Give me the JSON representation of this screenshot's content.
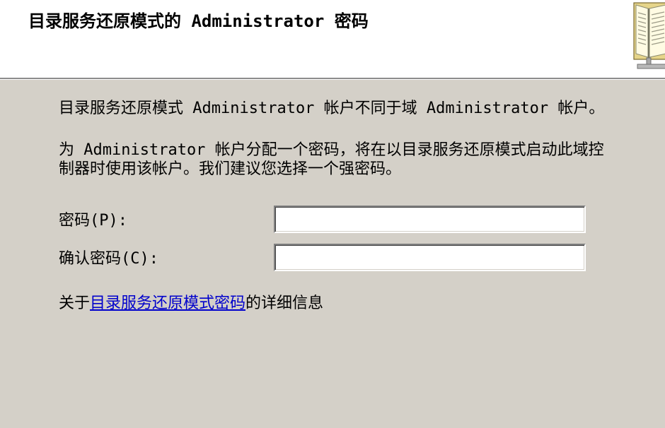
{
  "header": {
    "title": "目录服务还原模式的 Administrator 密码",
    "icon": "book-icon"
  },
  "body": {
    "intro": "目录服务还原模式 Administrator 帐户不同于域 Administrator 帐户。",
    "instruction": "为 Administrator 帐户分配一个密码，将在以目录服务还原模式启动此域控制器时使用该帐户。我们建议您选择一个强密码。",
    "password": {
      "label": "密码(P):",
      "value": ""
    },
    "confirm_password": {
      "label": "确认密码(C):",
      "value": ""
    },
    "more_info": {
      "prefix": "关于",
      "link": "目录服务还原模式密码",
      "suffix": "的详细信息"
    }
  },
  "colors": {
    "page_background": "#D4D0C8",
    "header_background": "#FFFFFF",
    "link": "#0000CC"
  }
}
